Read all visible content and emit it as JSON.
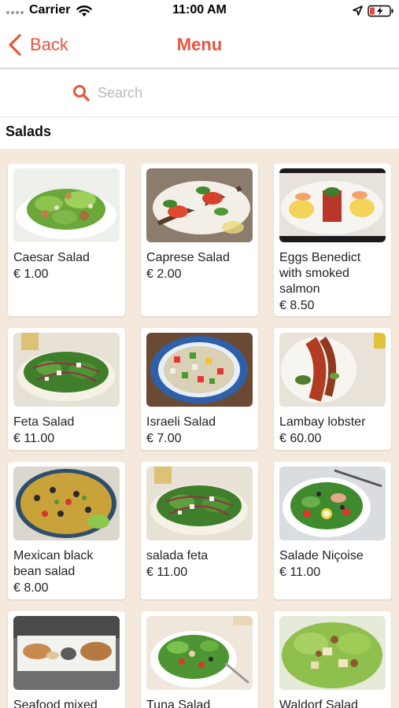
{
  "status_bar": {
    "carrier": "Carrier",
    "time": "11:00 AM"
  },
  "nav": {
    "back_label": "Back",
    "title": "Menu"
  },
  "search": {
    "placeholder": "Search",
    "value": ""
  },
  "section": {
    "title": "Salads"
  },
  "items": [
    {
      "name": "Caesar Salad",
      "price": "€ 1.00",
      "image_icon": "caesar-salad-photo"
    },
    {
      "name": "Caprese Salad",
      "price": "€ 2.00",
      "image_icon": "caprese-salad-photo"
    },
    {
      "name": "Eggs Benedict with smoked salmon",
      "price": "€ 8.50",
      "image_icon": "eggs-benedict-photo"
    },
    {
      "name": "Feta Salad",
      "price": "€ 11.00",
      "image_icon": "feta-salad-photo"
    },
    {
      "name": "Israeli Salad",
      "price": "€ 7.00",
      "image_icon": "israeli-salad-photo"
    },
    {
      "name": "Lambay lobster",
      "price": "€ 60.00",
      "image_icon": "lobster-photo"
    },
    {
      "name": "Mexican black bean salad",
      "price": "€ 8.00",
      "image_icon": "black-bean-salad-photo"
    },
    {
      "name": "salada feta",
      "price": "€ 11.00",
      "image_icon": "feta-salad-photo"
    },
    {
      "name": "Salade Niçoise",
      "price": "€ 11.00",
      "image_icon": "nicoise-salad-photo"
    },
    {
      "name": "Seafood mixed",
      "price": "",
      "image_icon": "seafood-photo"
    },
    {
      "name": "Tuna Salad",
      "price": "",
      "image_icon": "tuna-salad-photo"
    },
    {
      "name": "Waldorf Salad",
      "price": "",
      "image_icon": "waldorf-salad-photo"
    }
  ],
  "colors": {
    "accent": "#e8563d",
    "grid_background": "#f4e9dc"
  }
}
